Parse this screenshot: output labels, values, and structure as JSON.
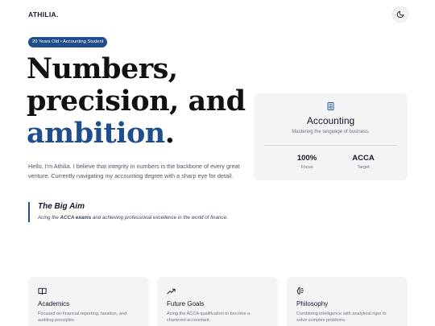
{
  "header": {
    "brand": "ATHILIA.",
    "theme_toggle_icon": "moon-icon"
  },
  "hero": {
    "badge": "20 Years Old • Accounting Student",
    "line1": "Numbers,",
    "line2": "precision, and",
    "line3_accent": "ambition",
    "line3_end": ".",
    "intro": "Hello, I'm Athilia. I believe that integrity in numbers is the backbone of every great venture. Currently navigating my accounting degree with a sharp eye for detail."
  },
  "aim": {
    "title": "The Big Aim",
    "text_before": "Acing the ",
    "text_bold": "ACCA exams",
    "text_after": " and achieving professional excellence in the world of finance."
  },
  "accounting_card": {
    "icon": "calculator-icon",
    "title": "Accounting",
    "subtitle": "Mastering the language of business.",
    "stats": [
      {
        "value": "100%",
        "label": "Focus"
      },
      {
        "value": "ACCA",
        "label": "Target"
      }
    ]
  },
  "features": [
    {
      "icon": "book-icon",
      "title": "Academics",
      "text": "Focused on financial reporting, taxation, and auditing principles."
    },
    {
      "icon": "trending-up-icon",
      "title": "Future Goals",
      "text": "Acing the ACCA qualification to become a chartered accountant."
    },
    {
      "icon": "brain-icon",
      "title": "Philosophy",
      "text": "Combining intelligence with analytical rigor to solve complex problems."
    }
  ],
  "colors": {
    "accent": "#1e4e8c",
    "card_bg": "#f3f4f6"
  }
}
